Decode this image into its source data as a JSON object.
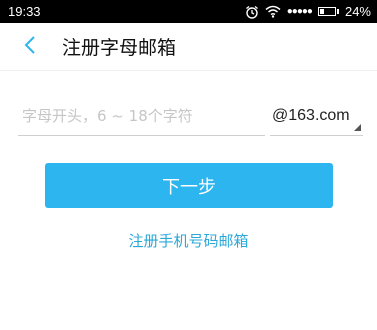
{
  "status_bar": {
    "time": "19:33",
    "signal": "●●●●●",
    "battery_percent": "24%",
    "battery_level": 0.24,
    "icons": [
      "alarm-icon",
      "wifi-icon",
      "battery-icon"
    ]
  },
  "header": {
    "back_icon": "chevron-left-icon",
    "title": "注册字母邮箱"
  },
  "form": {
    "email_placeholder": "字母开头，6 ~ 18个字符",
    "email_value": "",
    "domain": "@163.com"
  },
  "actions": {
    "next_label": "下一步",
    "phone_link_label": "注册手机号码邮箱"
  },
  "colors": {
    "accent": "#2cb5ee",
    "link": "#2aa8d8",
    "status_bar_bg": "#000000"
  }
}
